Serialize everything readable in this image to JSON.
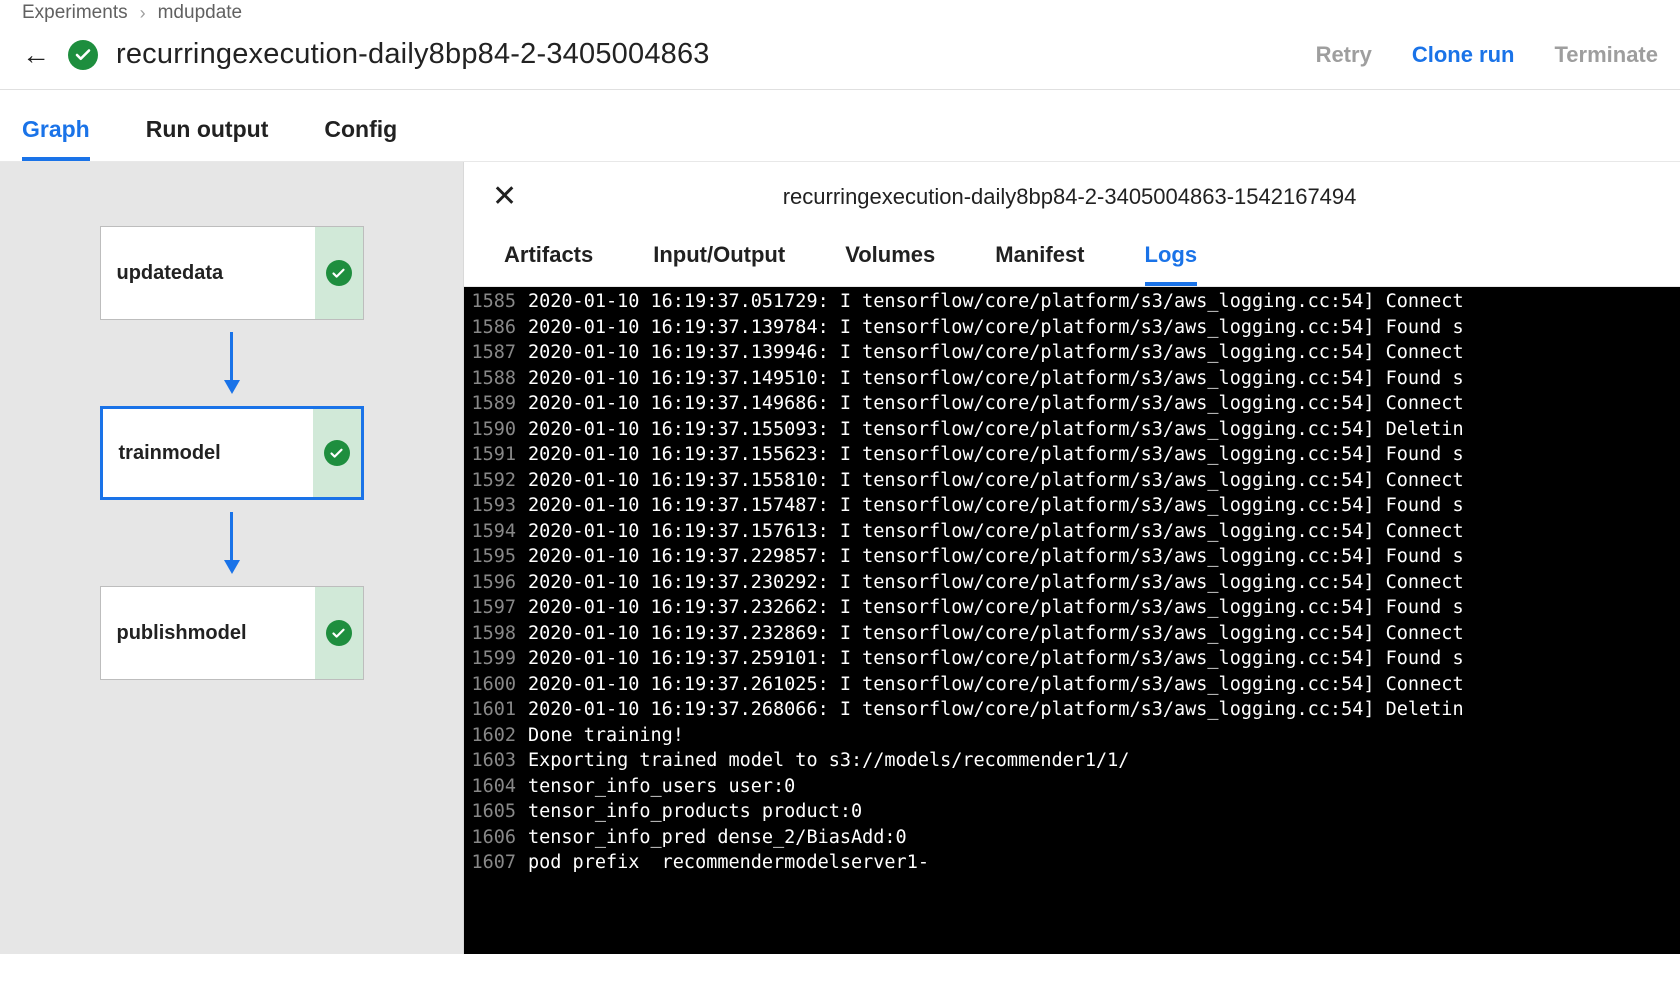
{
  "breadcrumb": {
    "root": "Experiments",
    "current": "mdupdate"
  },
  "header": {
    "title": "recurringexecution-daily8bp84-2-3405004863",
    "actions": {
      "retry": "Retry",
      "clone": "Clone run",
      "terminate": "Terminate"
    }
  },
  "tabs": {
    "graph": "Graph",
    "runoutput": "Run output",
    "config": "Config"
  },
  "graph": {
    "nodes": [
      {
        "label": "updatedata",
        "success": true,
        "selected": false
      },
      {
        "label": "trainmodel",
        "success": true,
        "selected": true
      },
      {
        "label": "publishmodel",
        "success": true,
        "selected": false
      }
    ]
  },
  "panel": {
    "title": "recurringexecution-daily8bp84-2-3405004863-1542167494",
    "tabs": {
      "artifacts": "Artifacts",
      "io": "Input/Output",
      "volumes": "Volumes",
      "manifest": "Manifest",
      "logs": "Logs"
    }
  },
  "logs": [
    {
      "n": "1585",
      "t": "2020-01-10 16:19:37.051729: I tensorflow/core/platform/s3/aws_logging.cc:54] Connect"
    },
    {
      "n": "1586",
      "t": "2020-01-10 16:19:37.139784: I tensorflow/core/platform/s3/aws_logging.cc:54] Found s"
    },
    {
      "n": "1587",
      "t": "2020-01-10 16:19:37.139946: I tensorflow/core/platform/s3/aws_logging.cc:54] Connect"
    },
    {
      "n": "1588",
      "t": "2020-01-10 16:19:37.149510: I tensorflow/core/platform/s3/aws_logging.cc:54] Found s"
    },
    {
      "n": "1589",
      "t": "2020-01-10 16:19:37.149686: I tensorflow/core/platform/s3/aws_logging.cc:54] Connect"
    },
    {
      "n": "1590",
      "t": "2020-01-10 16:19:37.155093: I tensorflow/core/platform/s3/aws_logging.cc:54] Deletin"
    },
    {
      "n": "1591",
      "t": "2020-01-10 16:19:37.155623: I tensorflow/core/platform/s3/aws_logging.cc:54] Found s"
    },
    {
      "n": "1592",
      "t": "2020-01-10 16:19:37.155810: I tensorflow/core/platform/s3/aws_logging.cc:54] Connect"
    },
    {
      "n": "1593",
      "t": "2020-01-10 16:19:37.157487: I tensorflow/core/platform/s3/aws_logging.cc:54] Found s"
    },
    {
      "n": "1594",
      "t": "2020-01-10 16:19:37.157613: I tensorflow/core/platform/s3/aws_logging.cc:54] Connect"
    },
    {
      "n": "1595",
      "t": "2020-01-10 16:19:37.229857: I tensorflow/core/platform/s3/aws_logging.cc:54] Found s"
    },
    {
      "n": "1596",
      "t": "2020-01-10 16:19:37.230292: I tensorflow/core/platform/s3/aws_logging.cc:54] Connect"
    },
    {
      "n": "1597",
      "t": "2020-01-10 16:19:37.232662: I tensorflow/core/platform/s3/aws_logging.cc:54] Found s"
    },
    {
      "n": "1598",
      "t": "2020-01-10 16:19:37.232869: I tensorflow/core/platform/s3/aws_logging.cc:54] Connect"
    },
    {
      "n": "1599",
      "t": "2020-01-10 16:19:37.259101: I tensorflow/core/platform/s3/aws_logging.cc:54] Found s"
    },
    {
      "n": "1600",
      "t": "2020-01-10 16:19:37.261025: I tensorflow/core/platform/s3/aws_logging.cc:54] Connect"
    },
    {
      "n": "1601",
      "t": "2020-01-10 16:19:37.268066: I tensorflow/core/platform/s3/aws_logging.cc:54] Deletin"
    },
    {
      "n": "1602",
      "t": "Done training!"
    },
    {
      "n": "1603",
      "t": "Exporting trained model to s3://models/recommender1/1/"
    },
    {
      "n": "1604",
      "t": "tensor_info_users user:0"
    },
    {
      "n": "1605",
      "t": "tensor_info_products product:0"
    },
    {
      "n": "1606",
      "t": "tensor_info_pred dense_2/BiasAdd:0"
    },
    {
      "n": "1607",
      "t": "pod prefix  recommendermodelserver1-"
    }
  ]
}
